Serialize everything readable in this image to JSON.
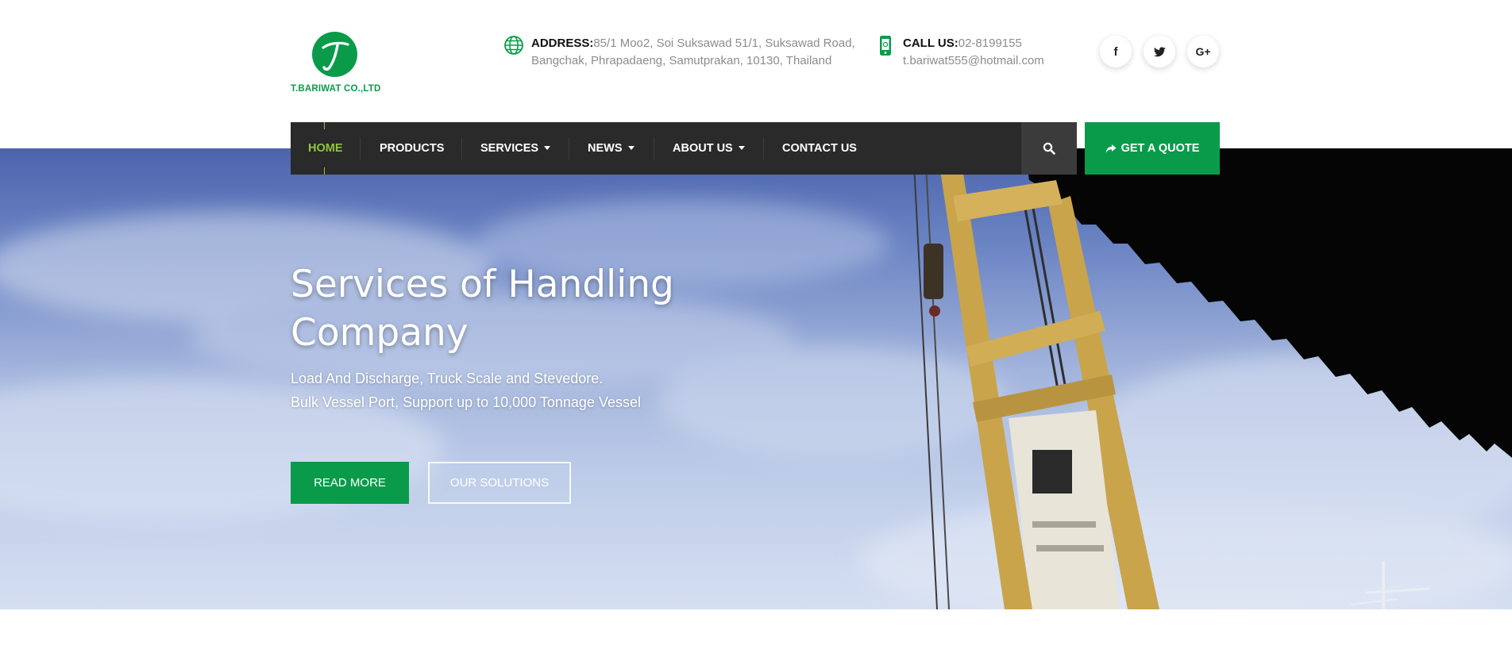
{
  "brand": {
    "name": "T.BARIWAT CO.,LTD",
    "logo_letter": "T",
    "color": "#0a9b4a"
  },
  "header": {
    "address": {
      "label": "ADDRESS:",
      "line1": "85/1 Moo2, Soi Suksawad 51/1, Suksawad Road,",
      "line2": "Bangchak, Phrapadaeng, Samutprakan, 10130, Thailand",
      "icon": "globe-icon"
    },
    "call": {
      "label": "CALL US:",
      "phone": "02-8199155",
      "email": "t.bariwat555@hotmail.com",
      "icon": "mobile-phone-icon"
    },
    "social": [
      {
        "label": "f",
        "icon": "facebook-icon"
      },
      {
        "label": "✨",
        "icon": "twitter-icon"
      },
      {
        "label": "G+",
        "icon": "google-plus-icon"
      }
    ]
  },
  "nav": {
    "items": [
      {
        "label": "HOME",
        "active": true
      },
      {
        "label": "PRODUCTS"
      },
      {
        "label": "SERVICES",
        "dropdown": true
      },
      {
        "label": "NEWS",
        "dropdown": true
      },
      {
        "label": "ABOUT US",
        "dropdown": true
      },
      {
        "label": "CONTACT US"
      }
    ],
    "search_icon": "search-icon",
    "quote_label": "GET A QUOTE",
    "quote_icon": "share-arrow-icon",
    "active_color": "#8dc63f"
  },
  "hero": {
    "title_line1": "Services of Handling",
    "title_line2": "Company",
    "subtitle_line1": "Load And Discharge, Truck Scale and Stevedore.",
    "subtitle_line2": "Bulk Vessel Port, Support up to 10,000 Tonnage Vessel",
    "read_more": "READ MORE",
    "solutions": "OUR SOLUTIONS"
  }
}
